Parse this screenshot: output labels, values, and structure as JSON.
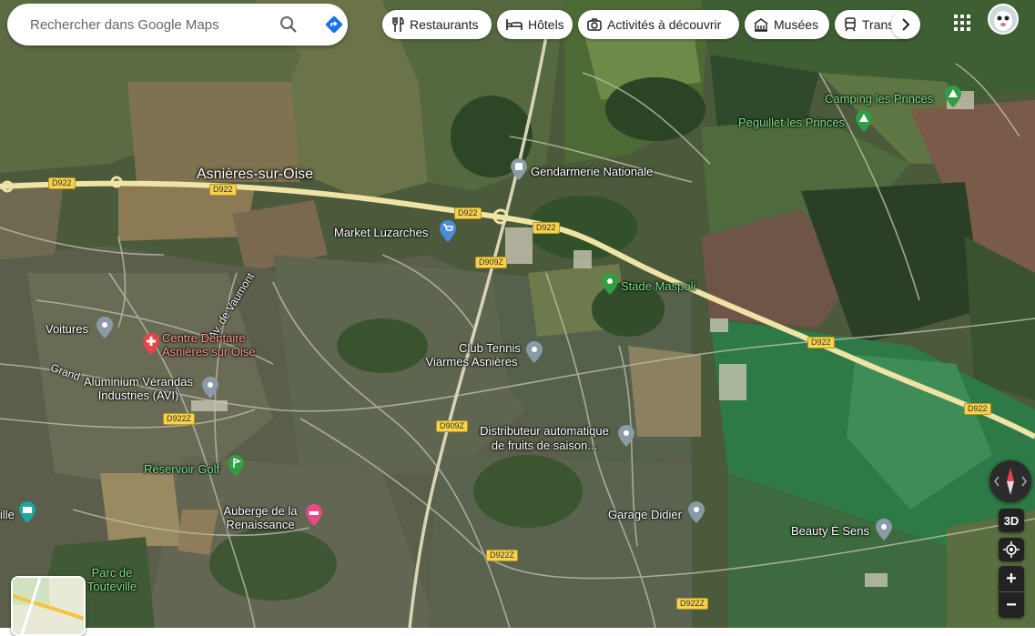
{
  "search": {
    "placeholder": "Rechercher dans Google Maps"
  },
  "chips": [
    {
      "label": "Restaurants"
    },
    {
      "label": "Hôtels"
    },
    {
      "label": "Activités à découvrir"
    },
    {
      "label": "Musées"
    },
    {
      "label": "Trans"
    }
  ],
  "places": {
    "town": "Asnières-sur-Oise",
    "camping": "Camping les Princes",
    "peguillet": "Peguillet les Princes",
    "gendarmerie": "Gendarmerie Nationale",
    "market": "Market Luzarches",
    "stade": "Stade Maspoli",
    "club_tennis_1": "Club Tennis",
    "club_tennis_2": "Viarmes Asnières",
    "voitures": "Voitures",
    "dentaire_1": "Centre Dentaire",
    "dentaire_2": "Asnières sur Oise",
    "alu_1": "Aluminium Vérandas",
    "alu_2": "Industries (AVI)",
    "distrib_1": "Distributeur automatique",
    "distrib_2": "de fruits de saison...",
    "golf": "Réservoir Golf",
    "auberge_1": "Auberge de la",
    "auberge_2": "Renaissance",
    "garage": "Garage Didier",
    "beauty": "Beauty É Sens",
    "parc_1": "Parc de",
    "parc_2": "Touteville",
    "ille": "ille",
    "street_vaumont": "Av. de Vaumont",
    "street_grand": "Grand"
  },
  "roads": {
    "d922": "D922",
    "d909z": "D909Z",
    "d922z": "D922Z"
  },
  "controls": {
    "three_d": "3D",
    "zoom_in": "+",
    "zoom_out": "−"
  },
  "colors": {
    "main_road": "#efe3a6",
    "road_label_bg": "#f7d24a",
    "pin_gray": "#8a9aa6",
    "pin_blue": "#4a8cdc",
    "pin_green": "#2f9e44",
    "pin_red": "#e8454a",
    "pin_pink": "#e94a84",
    "pin_teal": "#1fa6a0"
  }
}
